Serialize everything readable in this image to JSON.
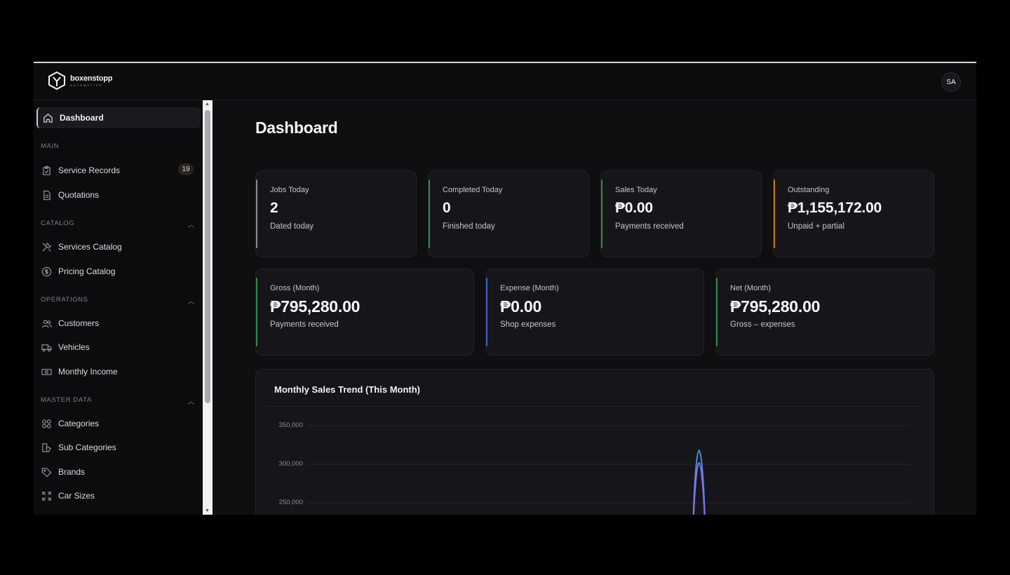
{
  "app": {
    "logo_name": "boxenstopp",
    "logo_sub": "AUTOMOTIVE",
    "user_initials": "SA"
  },
  "sidebar": {
    "active": {
      "label": "Dashboard",
      "icon": "home-icon"
    },
    "sections": [
      {
        "title": "MAIN",
        "collapsible": false,
        "items": [
          {
            "label": "Service Records",
            "icon": "clipboard-icon",
            "badge": "19"
          },
          {
            "label": "Quotations",
            "icon": "document-icon"
          }
        ]
      },
      {
        "title": "CATALOG",
        "collapsible": true,
        "items": [
          {
            "label": "Services Catalog",
            "icon": "wrench-icon"
          },
          {
            "label": "Pricing Catalog",
            "icon": "dollar-icon"
          }
        ]
      },
      {
        "title": "OPERATIONS",
        "collapsible": true,
        "items": [
          {
            "label": "Customers",
            "icon": "users-icon"
          },
          {
            "label": "Vehicles",
            "icon": "truck-icon"
          },
          {
            "label": "Monthly Income",
            "icon": "cash-icon"
          }
        ]
      },
      {
        "title": "MASTER DATA",
        "collapsible": true,
        "items": [
          {
            "label": "Categories",
            "icon": "grid-icon"
          },
          {
            "label": "Sub Categories",
            "icon": "subcategory-icon"
          },
          {
            "label": "Brands",
            "icon": "tag-icon"
          },
          {
            "label": "Car Sizes",
            "icon": "expand-icon"
          }
        ]
      }
    ]
  },
  "main": {
    "title": "Dashboard",
    "stats_row1": [
      {
        "label": "Jobs Today",
        "value": "2",
        "sub": "Dated today",
        "accent": "#8a8a90"
      },
      {
        "label": "Completed Today",
        "value": "0",
        "sub": "Finished today",
        "accent": "#2e8b4a"
      },
      {
        "label": "Sales Today",
        "value": "₱0.00",
        "sub": "Payments received",
        "accent": "#2e8b4a"
      },
      {
        "label": "Outstanding",
        "value": "₱1,155,172.00",
        "sub": "Unpaid + partial",
        "accent": "#c57a1c"
      }
    ],
    "stats_row2": [
      {
        "label": "Gross (Month)",
        "value": "₱795,280.00",
        "sub": "Payments received",
        "accent": "#2e8b4a"
      },
      {
        "label": "Expense (Month)",
        "value": "₱0.00",
        "sub": "Shop expenses",
        "accent": "#3a5fd0"
      },
      {
        "label": "Net (Month)",
        "value": "₱795,280.00",
        "sub": "Gross – expenses",
        "accent": "#2e8b4a"
      }
    ]
  },
  "chart_data": {
    "type": "line",
    "title": "Monthly Sales Trend (This Month)",
    "yticks": [
      "350,000",
      "300,000",
      "250,000"
    ],
    "ylim_visible": [
      230000,
      360000
    ],
    "series": [
      {
        "values_peak": 318000,
        "color": "#4a8fe8"
      },
      {
        "values_peak": 302000,
        "color": "#8b6fe0"
      }
    ],
    "peak_x_fraction": 0.65,
    "grid": true
  }
}
